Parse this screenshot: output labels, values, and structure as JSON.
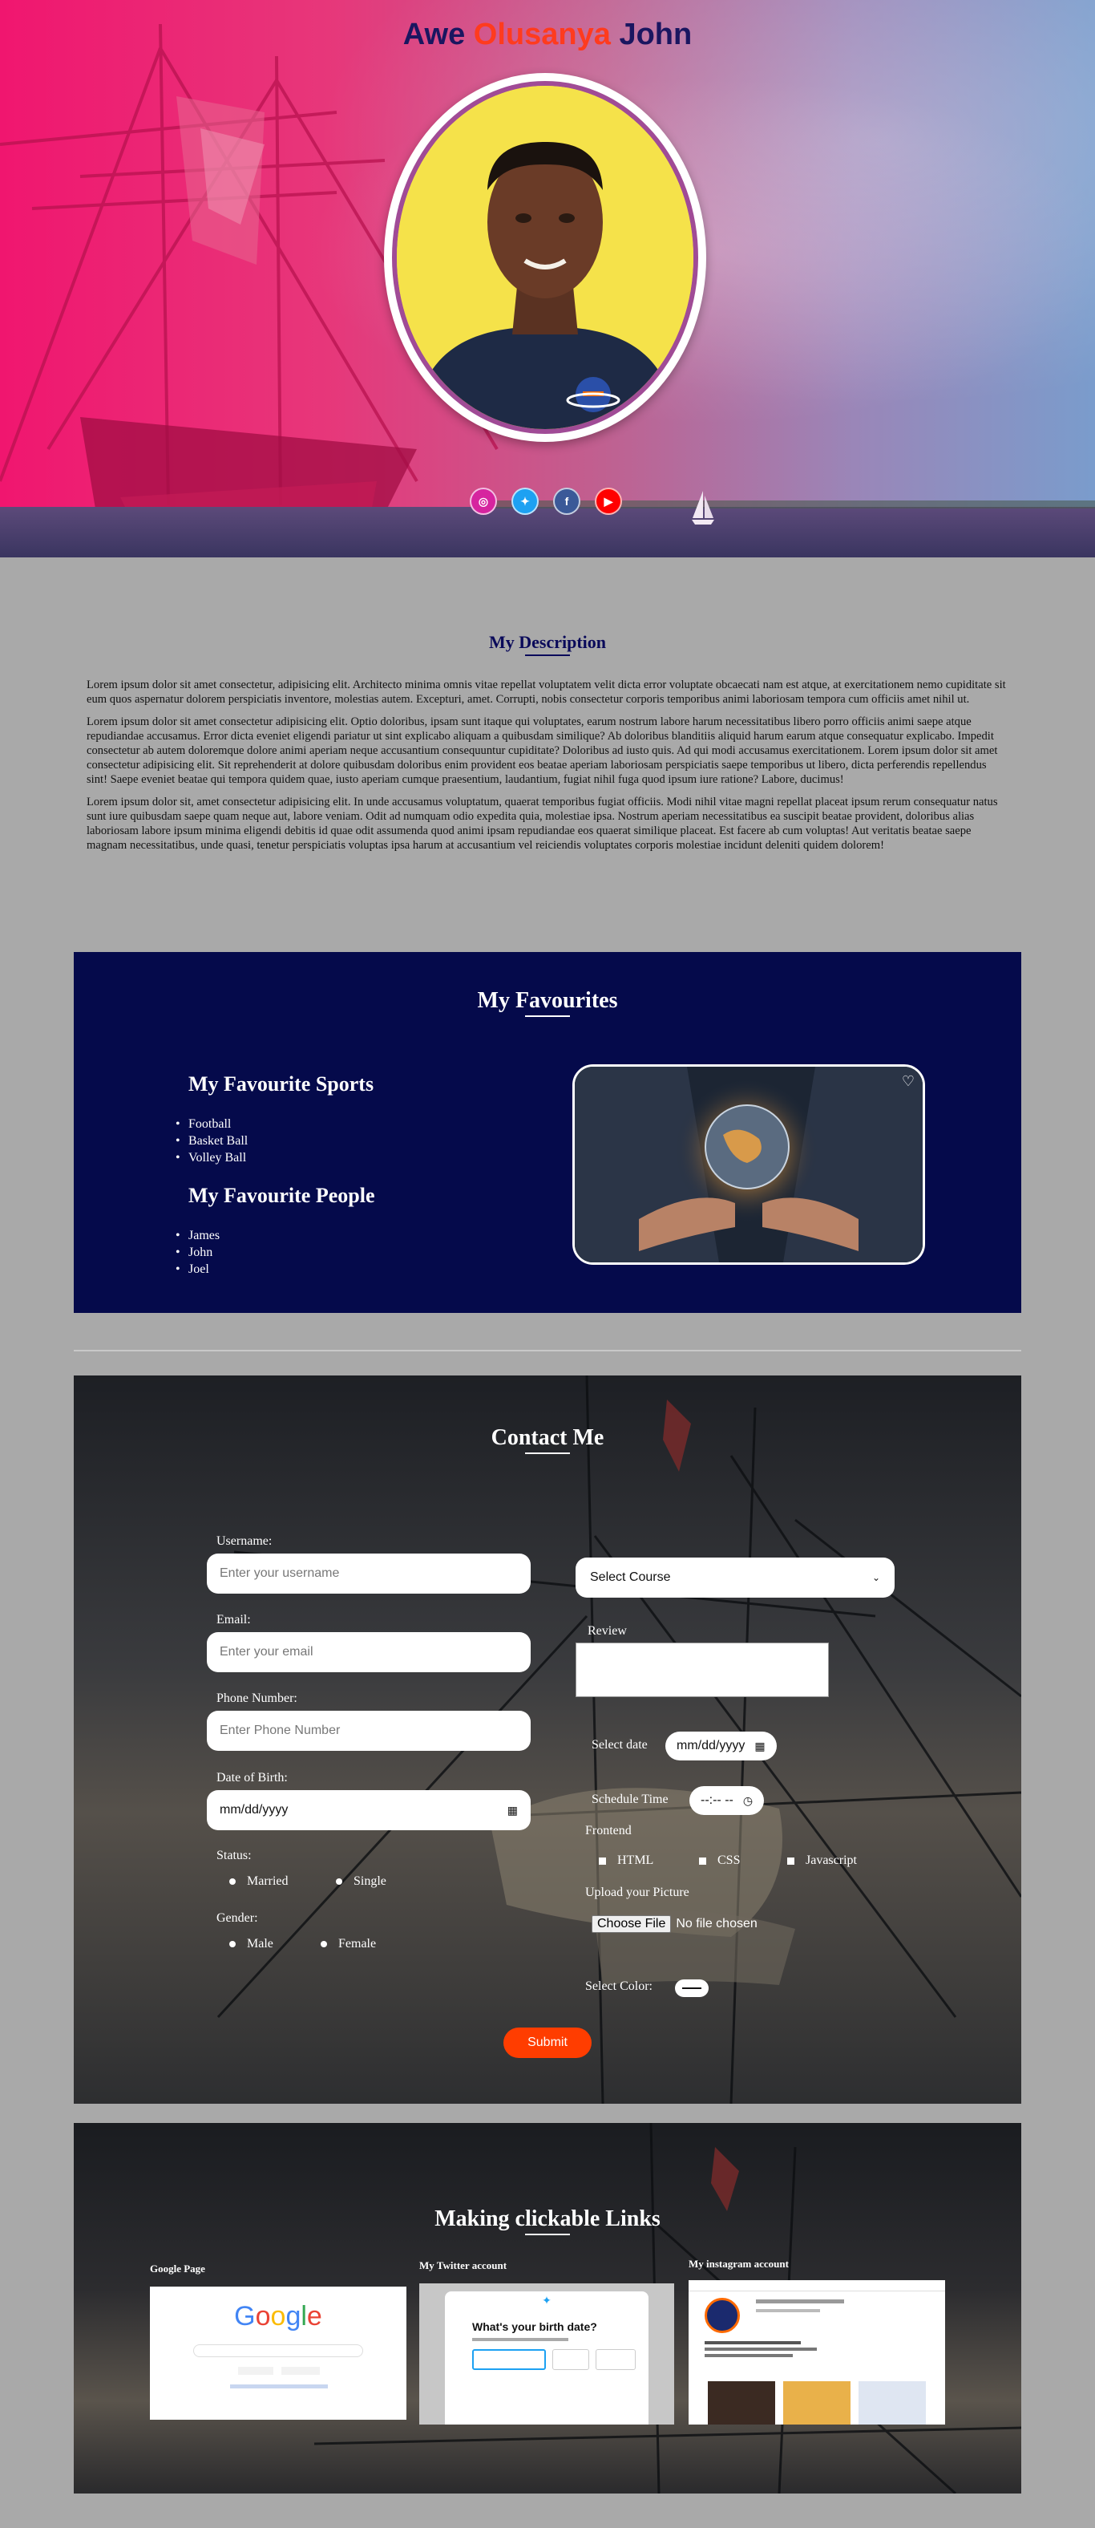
{
  "hero": {
    "name_first": "Awe",
    "name_middle": "Olusanya",
    "name_last": "John",
    "socials": [
      {
        "icon": "instagram-icon",
        "glyph": "◎",
        "color": "#d6249f"
      },
      {
        "icon": "twitter-icon",
        "glyph": "✦",
        "color": "#1da1f2"
      },
      {
        "icon": "facebook-icon",
        "glyph": "f",
        "color": "#3b5998"
      },
      {
        "icon": "youtube-icon",
        "glyph": "▶",
        "color": "#ff0000"
      }
    ]
  },
  "description": {
    "title": "My Description",
    "paragraphs": [
      "Lorem ipsum dolor sit amet consectetur, adipisicing elit. Architecto minima omnis vitae repellat voluptatem velit dicta error voluptate obcaecati nam est atque, at exercitationem nemo cupiditate sit eum quos aspernatur dolorem perspiciatis inventore, molestias autem. Excepturi, amet. Corrupti, nobis consectetur corporis temporibus animi laboriosam tempora cum officiis amet nihil ut.",
      "Lorem ipsum dolor sit amet consectetur adipisicing elit. Optio doloribus, ipsam sunt itaque qui voluptates, earum nostrum labore harum necessitatibus libero porro officiis animi saepe atque repudiandae accusamus. Error dicta eveniet eligendi pariatur ut sint explicabo aliquam a quibusdam similique? Ab doloribus blanditiis aliquid harum earum atque consequatur explicabo. Impedit consectetur ab autem doloremque dolore animi aperiam neque accusantium consequuntur cupiditate? Doloribus ad iusto quis. Ad qui modi accusamus exercitationem. Lorem ipsum dolor sit amet consectetur adipisicing elit. Sit reprehenderit at dolore quibusdam doloribus enim provident eos beatae aperiam laboriosam perspiciatis saepe temporibus ut libero, dicta perferendis repellendus sint! Saepe eveniet beatae qui tempora quidem quae, iusto aperiam cumque praesentium, laudantium, fugiat nihil fuga quod ipsum iure ratione? Labore, ducimus!",
      "Lorem ipsum dolor sit, amet consectetur adipisicing elit. In unde accusamus voluptatum, quaerat temporibus fugiat officiis. Modi nihil vitae magni repellat placeat ipsum rerum consequatur natus sunt iure quibusdam saepe quam neque aut, labore veniam. Odit ad numquam odio expedita quia, molestiae ipsa. Nostrum aperiam necessitatibus ea suscipit beatae provident, doloribus alias laboriosam labore ipsum minima eligendi debitis id quae odit assumenda quod animi ipsam repudiandae eos quaerat similique placeat. Est facere ab cum voluptas! Aut veritatis beatae saepe magnam necessitatibus, unde quasi, tenetur perspiciatis voluptas ipsa harum at accusantium vel reiciendis voluptates corporis molestiae incidunt deleniti quidem dolorem!"
    ]
  },
  "favourites": {
    "title": "My Favourites",
    "sports_heading": "My Favourite Sports",
    "sports": [
      "Football",
      "Basket Ball",
      "Volley Ball"
    ],
    "people_heading": "My Favourite People",
    "people": [
      "James",
      "John",
      "Joel"
    ],
    "heart_icon": "♡"
  },
  "contact": {
    "title": "Contact Me",
    "username_label": "Username:",
    "username_placeholder": "Enter your username",
    "email_label": "Email:",
    "email_placeholder": "Enter your email",
    "phone_label": "Phone Number:",
    "phone_placeholder": "Enter Phone Number",
    "dob_label": "Date of Birth:",
    "dob_value": "mm/dd/yyyy",
    "status_label": "Status:",
    "status_options": [
      "Married",
      "Single"
    ],
    "gender_label": "Gender:",
    "gender_options": [
      "Male",
      "Female"
    ],
    "course_select": "Select Course",
    "review_label": "Review",
    "select_date_label": "Select date",
    "select_date_value": "mm/dd/yyyy",
    "schedule_time_label": "Schedule Time",
    "schedule_time_value": "--:-- --",
    "frontend_label": "Frontend",
    "frontend_options": [
      "HTML",
      "CSS",
      "Javascript"
    ],
    "upload_label": "Upload your Picture",
    "choose_file": "Choose File",
    "no_file": "No file chosen",
    "select_color_label": "Select Color:",
    "submit": "Submit",
    "accent_color": "#ff3d00"
  },
  "links": {
    "title": "Making clickable Links",
    "google_caption": "Google Page",
    "twitter_caption": "My Twitter account",
    "instagram_caption": "My instagram account",
    "twitter_prompt": "What's your birth date?",
    "google_logo": "Google"
  },
  "colors": {
    "navy": "#050a4b",
    "title_navy": "#1a1660",
    "accent_red": "#ff3b1e",
    "background": "#a9a9a9"
  }
}
